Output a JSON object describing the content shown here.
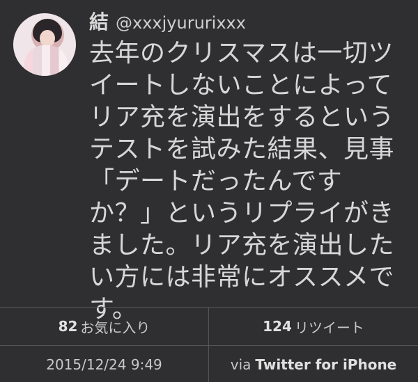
{
  "tweet": {
    "display_name": "結",
    "handle": "@xxxjyururixxx",
    "text_lines": [
      "去年のクリスマスは一切ツ",
      "イートしないことによって",
      "リア充を演出をするという",
      "テストを試みた結果、見事",
      "「デートだったんです",
      "か？」というリプライがき",
      "ました。リア充を演出した",
      "い方には非常にオススメで",
      "す。"
    ],
    "favorites_count": "82",
    "favorites_label": "お気に入り",
    "retweets_count": "124",
    "retweets_label": "リツイート",
    "timestamp": "2015/12/24 9:49",
    "via_label": "via",
    "source": "Twitter for iPhone"
  },
  "colors": {
    "background": "#2f2f31",
    "text": "#d7d7d7",
    "divider": "#555557"
  },
  "icons": {
    "avatar": "profile-photo"
  }
}
